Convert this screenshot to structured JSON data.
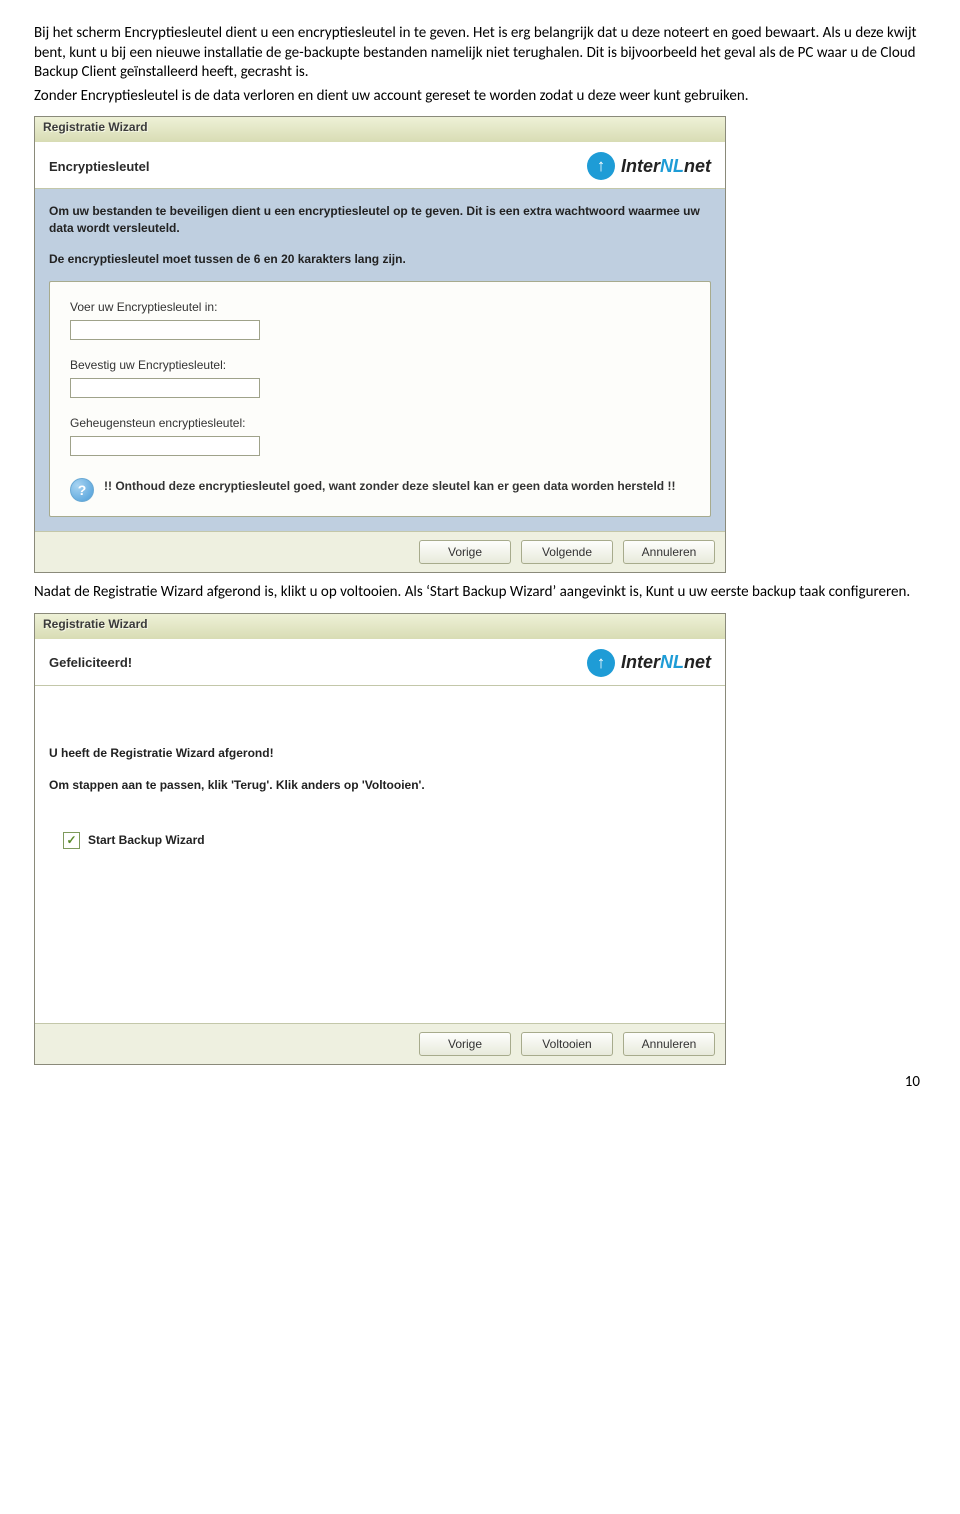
{
  "doc": {
    "p1": "Bij het scherm Encryptiesleutel dient u een encryptiesleutel in te geven. Het is erg belangrijk dat u deze noteert en goed bewaart. Als u deze kwijt bent, kunt u bij een nieuwe installatie de ge-backupte bestanden namelijk niet terughalen. Dit is bijvoorbeeld het geval als de PC waar u de Cloud Backup Client geïnstalleerd heeft, gecrasht is.",
    "p2": "Zonder Encryptiesleutel is de data verloren en dient uw account gereset te worden zodat u deze weer kunt gebruiken.",
    "between": "Nadat de Registratie Wizard afgerond is, klikt u op voltooien. Als ‘Start Backup Wizard’ aangevinkt is, Kunt u uw eerste backup taak configureren.",
    "page_number": "10"
  },
  "logo": {
    "icon_glyph": "↑",
    "part_inter": "Inter",
    "part_nl": "NL",
    "part_net": "net"
  },
  "wizard1": {
    "titlebar": "Registratie Wizard",
    "header_title": "Encryptiesleutel",
    "intro_line1": "Om uw bestanden te beveiligen dient u een encryptiesleutel op te geven. Dit is een extra wachtwoord waarmee uw data wordt versleuteld.",
    "intro_line2": "De encryptiesleutel moet tussen de 6 en 20 karakters lang zijn.",
    "labels": {
      "enter": "Voer uw Encryptiesleutel in:",
      "confirm": "Bevestig uw Encryptiesleutel:",
      "hint_name": "Geheugensteun encryptiesleutel:"
    },
    "values": {
      "enter": "",
      "confirm": "",
      "hint_name": ""
    },
    "hint": "!! Onthoud deze encryptiesleutel goed, want zonder deze sleutel kan er geen data worden hersteld !!",
    "buttons": {
      "prev": "Vorige",
      "next": "Volgende",
      "cancel": "Annuleren"
    }
  },
  "wizard2": {
    "titlebar": "Registratie Wizard",
    "header_title": "Gefeliciteerd!",
    "body_line1": "U heeft de Registratie Wizard afgerond!",
    "body_line2": "Om stappen aan te passen, klik 'Terug'. Klik anders op 'Voltooien'.",
    "checkbox_label": "Start Backup Wizard",
    "checkbox_glyph": "✓",
    "buttons": {
      "prev": "Vorige",
      "finish": "Voltooien",
      "cancel": "Annuleren"
    }
  }
}
